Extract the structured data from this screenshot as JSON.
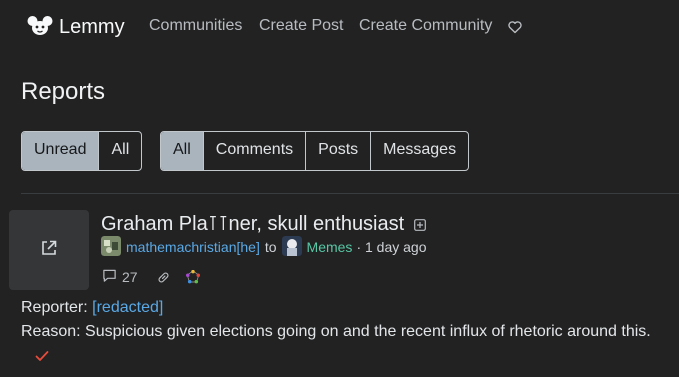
{
  "nav": {
    "brand": "Lemmy",
    "links": [
      "Communities",
      "Create Post",
      "Create Community"
    ],
    "donate_icon": "heart-icon"
  },
  "page": {
    "title": "Reports"
  },
  "filters": {
    "read_state": [
      "Unread",
      "All"
    ],
    "type": [
      "All",
      "Comments",
      "Posts",
      "Messages"
    ]
  },
  "report": {
    "post_title": "Graham Pla⊺⊺ner, skull enthusiast",
    "author": "mathemachristian[he]",
    "to_label": "to",
    "community": "Memes",
    "time": "· 1 day ago",
    "comments": "27",
    "reporter_label": "Reporter:",
    "reporter": "[redacted]",
    "reason_label": "Reason:",
    "reason": "Suspicious given elections going on and the recent influx of rhetoric around this."
  },
  "colors": {
    "background": "#222222",
    "link": "#5aa9e6",
    "community": "#57c7a5",
    "resolve": "#e74c3c",
    "active_button": "#aab4bd"
  }
}
